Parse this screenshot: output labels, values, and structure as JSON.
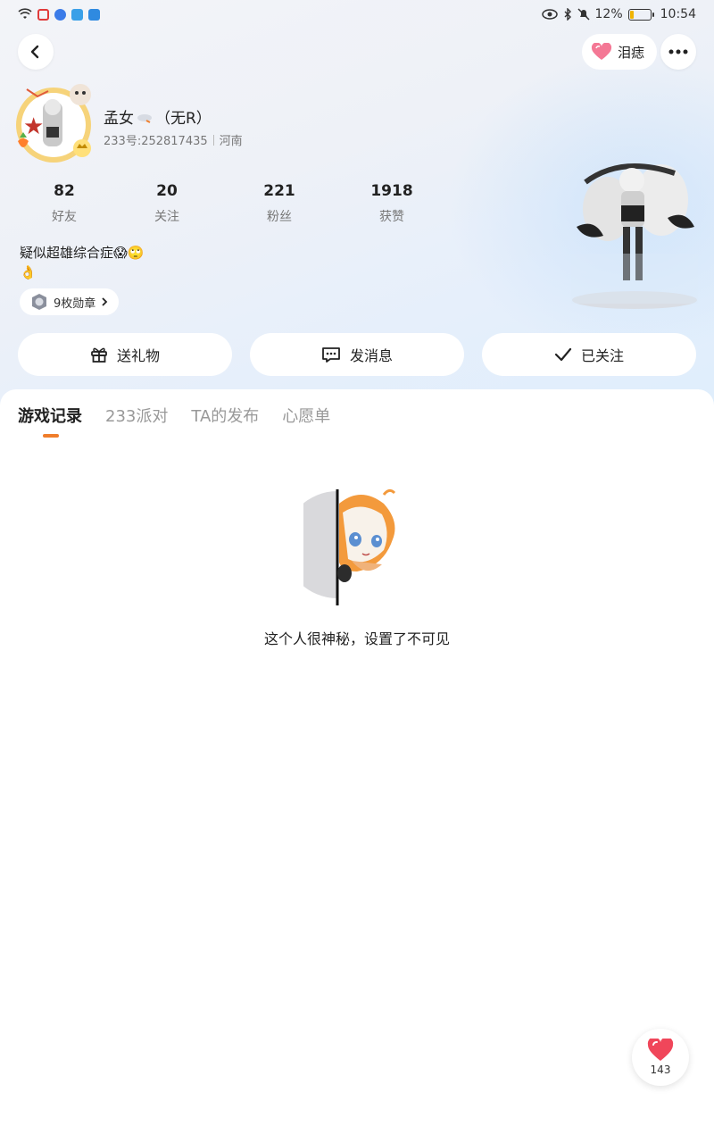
{
  "status_bar": {
    "battery": "12%",
    "time": "10:54",
    "battery_level": 0.12
  },
  "header": {
    "mole_label": "泪痣"
  },
  "profile": {
    "nickname": "孟女",
    "nickname_suffix": "（无R）",
    "id_text": "233号:252817435",
    "region": "河南",
    "bio_line1": "疑似超雄综合症😱🙄",
    "bio_line2": "👌",
    "badges_label": "9枚勋章"
  },
  "stats": [
    {
      "value": "82",
      "label": "好友"
    },
    {
      "value": "20",
      "label": "关注"
    },
    {
      "value": "221",
      "label": "粉丝"
    },
    {
      "value": "1918",
      "label": "获赞"
    }
  ],
  "actions": {
    "gift": "送礼物",
    "message": "发消息",
    "followed": "已关注"
  },
  "tabs": [
    {
      "label": "游戏记录",
      "active": true
    },
    {
      "label": "233派对",
      "active": false
    },
    {
      "label": "TA的发布",
      "active": false
    },
    {
      "label": "心愿单",
      "active": false
    }
  ],
  "empty_state": {
    "message": "这个人很神秘，设置了不可见"
  },
  "like_fab": {
    "count": "143"
  },
  "colors": {
    "accent": "#f07d2a",
    "heart": "#f0465a"
  }
}
